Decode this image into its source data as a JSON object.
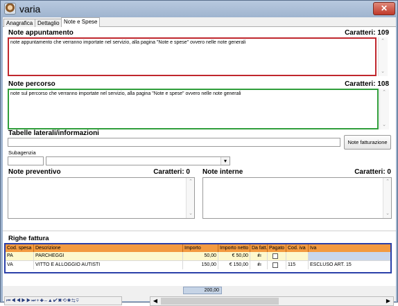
{
  "window": {
    "title": "varia",
    "close_icon": "✕"
  },
  "tabs": [
    {
      "label": "Anagrafica"
    },
    {
      "label": "Dettaglio"
    },
    {
      "label": "Note e Spese"
    }
  ],
  "note_appuntamento": {
    "label": "Note appuntamento",
    "counter": "Caratteri: 109",
    "value": "note appuntamento  che verranno importate nel servizio, alla pagina \"Note e spese\" ovvero nelle note generali",
    "border_color": "#c0272d"
  },
  "note_percorso": {
    "label": "Note percorso",
    "counter": "Caratteri: 108",
    "value": "note sul percorso che verranno importate nel servizio, alla pagina \"Note e spese\" ovvero nelle note generali",
    "border_color": "#2f9e3a"
  },
  "tabelle": {
    "label": "Tabelle laterali/informazioni",
    "value": "",
    "button": "Note fatturazione"
  },
  "subagenzia": {
    "label": "Subagenzia",
    "code": "",
    "selected": ""
  },
  "note_preventivo": {
    "label": "Note preventivo",
    "counter": "Caratteri: 0",
    "value": ""
  },
  "note_interne": {
    "label": "Note interne",
    "counter": "Caratteri: 0",
    "value": ""
  },
  "righe_fattura": {
    "label": "Righe fattura",
    "columns": [
      "Cod. spesa",
      "Descrizione",
      "Importo",
      "Importo netto",
      "Da fatt.",
      "Pagato",
      "Cod. iva",
      "Iva"
    ],
    "rows": [
      {
        "cod": "PA",
        "descrizione": "PARCHEGGI",
        "importo": "50,00",
        "netto": "€ 50,00",
        "da_fatt": "ı̸ıı",
        "cod_iva": "",
        "iva": ""
      },
      {
        "cod": "VA",
        "descrizione": "VITTO E ALLOGGIO AUTISTI",
        "importo": "150,00",
        "netto": "€ 150,00",
        "da_fatt": "ı̸ıı",
        "cod_iva": "115",
        "iva": "ESCLUSO ART. 15"
      }
    ],
    "border_color": "#2a3fa8",
    "header_color": "#f39a40"
  },
  "total": "200,00",
  "navigator": "⏮◀◀▶▶⏭+✚‒▲✔✖⟲✱⇆⊽",
  "icons": {
    "scroll_up": "⌃",
    "scroll_down": "⌄",
    "dropdown": "▾",
    "hscroll_left": "◀",
    "hscroll_right": "▶"
  }
}
